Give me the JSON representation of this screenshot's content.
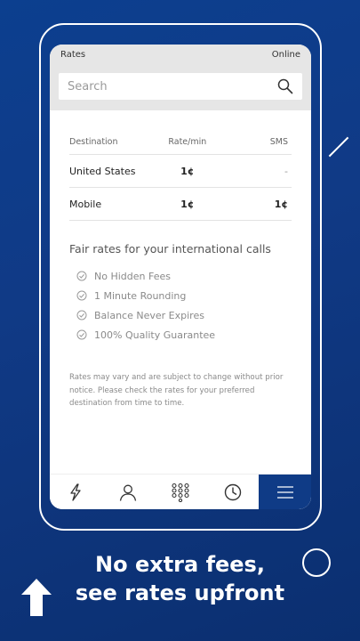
{
  "status": {
    "title": "Rates",
    "connection": "Online"
  },
  "search": {
    "placeholder": "Search"
  },
  "table": {
    "headers": [
      "Destination",
      "Rate/min",
      "SMS"
    ],
    "rows": [
      {
        "destination": "United States",
        "rate": "1¢",
        "sms": "-"
      },
      {
        "destination": "Mobile",
        "rate": "1¢",
        "sms": "1¢"
      }
    ]
  },
  "promo": {
    "title": "Fair rates for your international calls",
    "features": [
      "No Hidden Fees",
      "1 Minute Rounding",
      "Balance Never Expires",
      "100% Quality Guarantee"
    ]
  },
  "disclaimer": "Rates may vary and are subject to change without prior notice. Please check the rates for your preferred destination from time to time.",
  "nav": {
    "items": [
      "lightning-icon",
      "contacts-icon",
      "dialpad-icon",
      "history-icon",
      "menu-icon"
    ],
    "active": "menu-icon"
  },
  "headline": {
    "line1": "No extra fees,",
    "line2": "see rates upfront"
  },
  "colors": {
    "brand": "#0f3b86",
    "background": "#ffffff"
  }
}
